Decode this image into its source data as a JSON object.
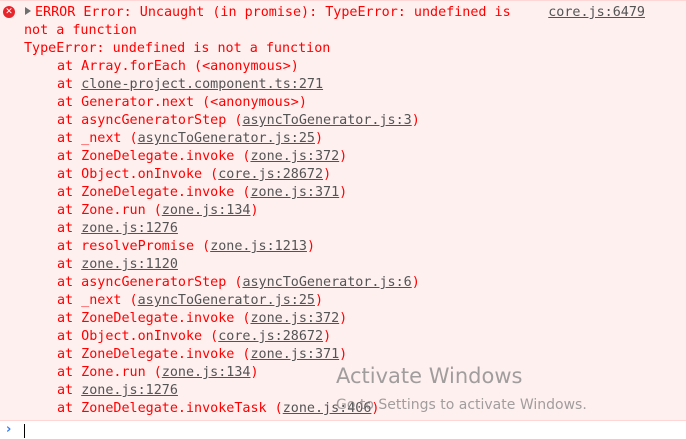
{
  "error": {
    "icon": "error-circle-icon",
    "first_line": "ERROR Error: Uncaught (in promise): TypeError: undefined is",
    "source_link": "core.js:6479",
    "continuation": "not a function",
    "type_line": "TypeError: undefined is not a function",
    "frames": [
      {
        "text": "at Array.forEach (<anonymous>)"
      },
      {
        "prefix": "at ",
        "loc": "clone-project.component.ts:271"
      },
      {
        "text": "at Generator.next (<anonymous>)"
      },
      {
        "prefix": "at asyncGeneratorStep (",
        "loc": "asyncToGenerator.js:3",
        "suffix": ")"
      },
      {
        "prefix": "at _next (",
        "loc": "asyncToGenerator.js:25",
        "suffix": ")"
      },
      {
        "prefix": "at ZoneDelegate.invoke (",
        "loc": "zone.js:372",
        "suffix": ")"
      },
      {
        "prefix": "at Object.onInvoke (",
        "loc": "core.js:28672",
        "suffix": ")"
      },
      {
        "prefix": "at ZoneDelegate.invoke (",
        "loc": "zone.js:371",
        "suffix": ")"
      },
      {
        "prefix": "at Zone.run (",
        "loc": "zone.js:134",
        "suffix": ")"
      },
      {
        "prefix": "at ",
        "loc": "zone.js:1276"
      },
      {
        "prefix": "at resolvePromise (",
        "loc": "zone.js:1213",
        "suffix": ")"
      },
      {
        "prefix": "at ",
        "loc": "zone.js:1120"
      },
      {
        "prefix": "at asyncGeneratorStep (",
        "loc": "asyncToGenerator.js:6",
        "suffix": ")"
      },
      {
        "prefix": "at _next (",
        "loc": "asyncToGenerator.js:25",
        "suffix": ")"
      },
      {
        "prefix": "at ZoneDelegate.invoke (",
        "loc": "zone.js:372",
        "suffix": ")"
      },
      {
        "prefix": "at Object.onInvoke (",
        "loc": "core.js:28672",
        "suffix": ")"
      },
      {
        "prefix": "at ZoneDelegate.invoke (",
        "loc": "zone.js:371",
        "suffix": ")"
      },
      {
        "prefix": "at Zone.run (",
        "loc": "zone.js:134",
        "suffix": ")"
      },
      {
        "prefix": "at ",
        "loc": "zone.js:1276"
      },
      {
        "prefix": "at ZoneDelegate.invokeTask (",
        "loc": "zone.js:406",
        "suffix": ")"
      }
    ]
  },
  "watermark": {
    "title": "Activate Windows",
    "subtitle": "Go to Settings to activate Windows."
  },
  "prompt": {
    "chevron_icon": "chevron-right-icon",
    "input_value": ""
  },
  "colors": {
    "error_text": "#ff0000",
    "error_bg": "#fff0f0",
    "link_text": "#545454",
    "prompt_accent": "#367cf1"
  }
}
